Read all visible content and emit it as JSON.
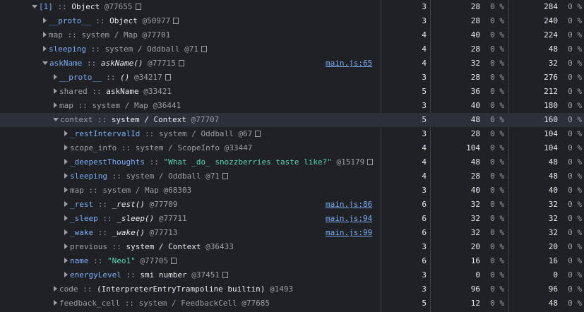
{
  "rows": [
    {
      "depth": 0,
      "toggle": "expanded",
      "prop": "[1]",
      "prop_style": "prop",
      "sep": " :: ",
      "cls": "Object",
      "cls_style": "",
      "oid": "@77655",
      "store": true,
      "link": "",
      "distance": "3",
      "shallow": "28",
      "shallow_pct": "0 %",
      "retained": "284",
      "retained_pct": "0 %",
      "selected": false
    },
    {
      "depth": 1,
      "toggle": "collapsed",
      "prop": "__proto__",
      "prop_style": "prop",
      "sep": " :: ",
      "cls": "Object",
      "cls_style": "",
      "oid": "@50977",
      "store": true,
      "link": "",
      "distance": "3",
      "shallow": "28",
      "shallow_pct": "0 %",
      "retained": "240",
      "retained_pct": "0 %",
      "selected": false
    },
    {
      "depth": 1,
      "toggle": "collapsed",
      "prop": "map",
      "prop_style": "plain",
      "sep": " :: ",
      "cls": "system / Map",
      "cls_style": "dim",
      "oid": "@77701",
      "store": false,
      "link": "",
      "distance": "4",
      "shallow": "40",
      "shallow_pct": "0 %",
      "retained": "224",
      "retained_pct": "0 %",
      "selected": false
    },
    {
      "depth": 1,
      "toggle": "collapsed",
      "prop": "sleeping",
      "prop_style": "prop",
      "sep": " :: ",
      "cls": "system / Oddball",
      "cls_style": "dim",
      "oid": "@71",
      "store": true,
      "link": "",
      "distance": "4",
      "shallow": "28",
      "shallow_pct": "0 %",
      "retained": "48",
      "retained_pct": "0 %",
      "selected": false
    },
    {
      "depth": 1,
      "toggle": "expanded",
      "prop": "askName",
      "prop_style": "prop",
      "sep": " :: ",
      "cls": "askName()",
      "cls_style": "it",
      "oid": "@77715",
      "store": true,
      "link": "main.js:65",
      "distance": "4",
      "shallow": "32",
      "shallow_pct": "0 %",
      "retained": "32",
      "retained_pct": "0 %",
      "selected": false
    },
    {
      "depth": 2,
      "toggle": "collapsed",
      "prop": "__proto__",
      "prop_style": "prop",
      "sep": " :: ",
      "cls": "()",
      "cls_style": "it",
      "oid": "@34217",
      "store": true,
      "link": "",
      "distance": "3",
      "shallow": "28",
      "shallow_pct": "0 %",
      "retained": "276",
      "retained_pct": "0 %",
      "selected": false
    },
    {
      "depth": 2,
      "toggle": "collapsed",
      "prop": "shared",
      "prop_style": "plain",
      "sep": " :: ",
      "cls": "askName",
      "cls_style": "",
      "oid": "@33421",
      "store": false,
      "link": "",
      "distance": "5",
      "shallow": "36",
      "shallow_pct": "0 %",
      "retained": "212",
      "retained_pct": "0 %",
      "selected": false
    },
    {
      "depth": 2,
      "toggle": "collapsed",
      "prop": "map",
      "prop_style": "plain",
      "sep": " :: ",
      "cls": "system / Map",
      "cls_style": "dim",
      "oid": "@36441",
      "store": false,
      "link": "",
      "distance": "3",
      "shallow": "40",
      "shallow_pct": "0 %",
      "retained": "180",
      "retained_pct": "0 %",
      "selected": false
    },
    {
      "depth": 2,
      "toggle": "expanded",
      "prop": "context",
      "prop_style": "plain",
      "sep": " :: ",
      "cls": "system / Context",
      "cls_style": "",
      "oid": "@77707",
      "store": false,
      "link": "",
      "distance": "5",
      "shallow": "48",
      "shallow_pct": "0 %",
      "retained": "160",
      "retained_pct": "0 %",
      "selected": true
    },
    {
      "depth": 3,
      "toggle": "collapsed",
      "prop": "_restIntervalId",
      "prop_style": "prop",
      "sep": " :: ",
      "cls": "system / Oddball",
      "cls_style": "dim",
      "oid": "@67",
      "store": true,
      "link": "",
      "distance": "3",
      "shallow": "28",
      "shallow_pct": "0 %",
      "retained": "104",
      "retained_pct": "0 %",
      "selected": false
    },
    {
      "depth": 3,
      "toggle": "collapsed",
      "prop": "scope_info",
      "prop_style": "plain",
      "sep": " :: ",
      "cls": "system / ScopeInfo",
      "cls_style": "dim",
      "oid": "@33447",
      "store": false,
      "link": "",
      "distance": "4",
      "shallow": "104",
      "shallow_pct": "0 %",
      "retained": "104",
      "retained_pct": "0 %",
      "selected": false
    },
    {
      "depth": 3,
      "toggle": "collapsed",
      "prop": "_deepestThoughts",
      "prop_style": "prop",
      "sep": " :: ",
      "cls": "\"What _do_ snozzberries taste like?\"",
      "cls_style": "str",
      "oid": "@15179",
      "store": true,
      "link": "",
      "distance": "4",
      "shallow": "48",
      "shallow_pct": "0 %",
      "retained": "48",
      "retained_pct": "0 %",
      "selected": false
    },
    {
      "depth": 3,
      "toggle": "collapsed",
      "prop": "sleeping",
      "prop_style": "prop",
      "sep": " :: ",
      "cls": "system / Oddball",
      "cls_style": "dim",
      "oid": "@71",
      "store": true,
      "link": "",
      "distance": "4",
      "shallow": "28",
      "shallow_pct": "0 %",
      "retained": "48",
      "retained_pct": "0 %",
      "selected": false
    },
    {
      "depth": 3,
      "toggle": "collapsed",
      "prop": "map",
      "prop_style": "plain",
      "sep": " :: ",
      "cls": "system / Map",
      "cls_style": "dim",
      "oid": "@68303",
      "store": false,
      "link": "",
      "distance": "3",
      "shallow": "40",
      "shallow_pct": "0 %",
      "retained": "40",
      "retained_pct": "0 %",
      "selected": false
    },
    {
      "depth": 3,
      "toggle": "collapsed",
      "prop": "_rest",
      "prop_style": "prop",
      "sep": " :: ",
      "cls": "_rest()",
      "cls_style": "it",
      "oid": "@77709",
      "store": false,
      "link": "main.js:86",
      "distance": "6",
      "shallow": "32",
      "shallow_pct": "0 %",
      "retained": "32",
      "retained_pct": "0 %",
      "selected": false
    },
    {
      "depth": 3,
      "toggle": "collapsed",
      "prop": "_sleep",
      "prop_style": "prop",
      "sep": " :: ",
      "cls": "_sleep()",
      "cls_style": "it",
      "oid": "@77711",
      "store": false,
      "link": "main.js:94",
      "distance": "6",
      "shallow": "32",
      "shallow_pct": "0 %",
      "retained": "32",
      "retained_pct": "0 %",
      "selected": false
    },
    {
      "depth": 3,
      "toggle": "collapsed",
      "prop": "_wake",
      "prop_style": "prop",
      "sep": " :: ",
      "cls": "_wake()",
      "cls_style": "it",
      "oid": "@77713",
      "store": false,
      "link": "main.js:99",
      "distance": "6",
      "shallow": "32",
      "shallow_pct": "0 %",
      "retained": "32",
      "retained_pct": "0 %",
      "selected": false
    },
    {
      "depth": 3,
      "toggle": "collapsed",
      "prop": "previous",
      "prop_style": "plain",
      "sep": " :: ",
      "cls": "system / Context",
      "cls_style": "",
      "oid": "@36433",
      "store": false,
      "link": "",
      "distance": "3",
      "shallow": "20",
      "shallow_pct": "0 %",
      "retained": "20",
      "retained_pct": "0 %",
      "selected": false
    },
    {
      "depth": 3,
      "toggle": "collapsed",
      "prop": "name",
      "prop_style": "prop",
      "sep": " :: ",
      "cls": "\"Neo1\"",
      "cls_style": "str",
      "oid": "@77705",
      "store": true,
      "link": "",
      "distance": "6",
      "shallow": "16",
      "shallow_pct": "0 %",
      "retained": "16",
      "retained_pct": "0 %",
      "selected": false
    },
    {
      "depth": 3,
      "toggle": "collapsed",
      "prop": "energyLevel",
      "prop_style": "prop",
      "sep": " :: ",
      "cls": "smi number",
      "cls_style": "",
      "oid": "@37451",
      "store": true,
      "link": "",
      "distance": "3",
      "shallow": "0",
      "shallow_pct": "0 %",
      "retained": "0",
      "retained_pct": "0 %",
      "selected": false
    },
    {
      "depth": 2,
      "toggle": "collapsed",
      "prop": "code",
      "prop_style": "plain",
      "sep": " :: ",
      "cls": "(InterpreterEntryTrampoline builtin)",
      "cls_style": "",
      "oid": "@1493",
      "store": false,
      "link": "",
      "distance": "3",
      "shallow": "96",
      "shallow_pct": "0 %",
      "retained": "96",
      "retained_pct": "0 %",
      "selected": false
    },
    {
      "depth": 2,
      "toggle": "collapsed",
      "prop": "feedback_cell",
      "prop_style": "plain",
      "sep": " :: ",
      "cls": "system / FeedbackCell",
      "cls_style": "dim",
      "oid": "@77685",
      "store": false,
      "link": "",
      "distance": "5",
      "shallow": "12",
      "shallow_pct": "0 %",
      "retained": "48",
      "retained_pct": "0 %",
      "selected": false
    }
  ]
}
